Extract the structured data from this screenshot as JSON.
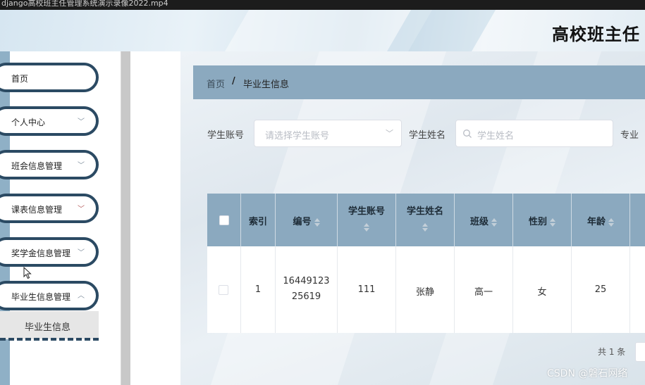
{
  "window": {
    "title": "django高校班主任管理系统演示录像2022.mp4"
  },
  "header": {
    "site_title": "高校班主任"
  },
  "sidebar": {
    "items": [
      {
        "label": "首页",
        "chevron": ""
      },
      {
        "label": "个人中心",
        "chevron": "chevron-down-icon"
      },
      {
        "label": "班会信息管理",
        "chevron": "chevron-down-icon"
      },
      {
        "label": "课表信息管理",
        "chevron": "chevron-down-icon"
      },
      {
        "label": "奖学金信息管理",
        "chevron": "chevron-down-icon"
      },
      {
        "label": "毕业生信息管理",
        "chevron": "chevron-down-icon"
      }
    ],
    "active_submenu": {
      "label": "毕业生信息"
    }
  },
  "breadcrumb": {
    "home": "首页",
    "separator": "/",
    "current": "毕业生信息"
  },
  "search": {
    "student_account_label": "学生账号",
    "student_account_placeholder": "请选择学生账号",
    "student_name_label": "学生姓名",
    "student_name_placeholder": "学生姓名",
    "major_label": "专业"
  },
  "table": {
    "columns": [
      "索引",
      "编号",
      "学生账号",
      "学生姓名",
      "班级",
      "性别",
      "年龄"
    ],
    "rows": [
      {
        "index": "1",
        "id_line1": "16449123",
        "id_line2": "25619",
        "account": "111",
        "name": "张静",
        "class": "高一",
        "gender": "女",
        "age": "25"
      }
    ]
  },
  "pagination": {
    "total_text": "共 1 条"
  },
  "watermark": {
    "text": "CSDN @磐石网络"
  },
  "colors": {
    "sidebar_border": "#2b4a63",
    "table_header": "#8ba9bf",
    "breadcrumb_bg": "#8ba9bf"
  }
}
